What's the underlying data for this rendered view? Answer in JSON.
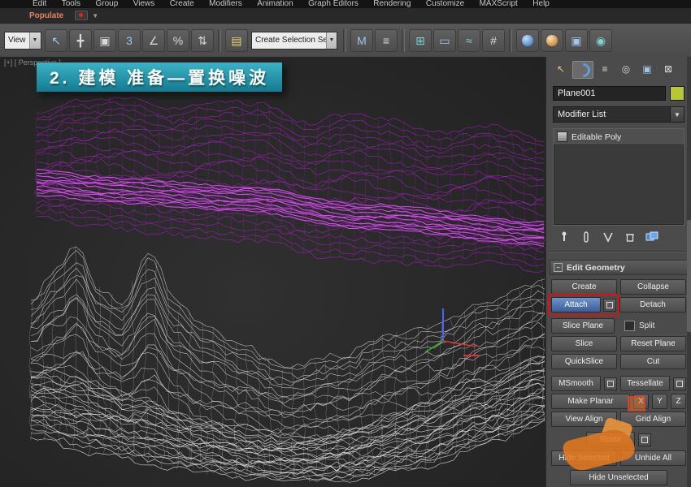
{
  "menu": {
    "items": [
      "Edit",
      "Tools",
      "Group",
      "Views",
      "Create",
      "Modifiers",
      "Animation",
      "Graph Editors",
      "Rendering",
      "Customize",
      "MAXScript",
      "Help"
    ]
  },
  "populate_bar": {
    "label": "Populate"
  },
  "toolbar": {
    "coordinate_system": "View",
    "selection_set_placeholder": "Create Selection Se",
    "snap_label": "3"
  },
  "viewport": {
    "label": "[+] [ Perspective ]",
    "overlay_title": "2. 建模 准备—置换噪波"
  },
  "command_panel": {
    "object_name": "Plane001",
    "modifier_list": "Modifier List",
    "stack": [
      {
        "label": "Editable Poly"
      }
    ],
    "rollout": {
      "title": "Edit Geometry",
      "create": "Create",
      "collapse": "Collapse",
      "attach": "Attach",
      "detach": "Detach",
      "slice_plane": "Slice Plane",
      "split": "Split",
      "slice": "Slice",
      "reset_plane": "Reset Plane",
      "quickslice": "QuickSlice",
      "cut": "Cut",
      "msmooth": "MSmooth",
      "tessellate": "Tessellate",
      "make_planar": "Make Planar",
      "axis_x": "X",
      "axis_y": "Y",
      "axis_z": "Z",
      "view_align": "View Align",
      "grid_align": "Grid Align",
      "relax": "Relax",
      "hide_selected": "Hide Selected",
      "unhide_all": "Unhide All",
      "hide_unselected": "Hide Unselected"
    }
  },
  "colors": {
    "banner_teal": "#1f93a8",
    "annotation_red": "#dd1111",
    "purple_wire": "#b41ed2",
    "purple_wire_bright": "#d94cf2",
    "white_wire": "#dcdcdc",
    "white_wire_bright": "#ffffff",
    "object_color_swatch": "#b7c832"
  }
}
